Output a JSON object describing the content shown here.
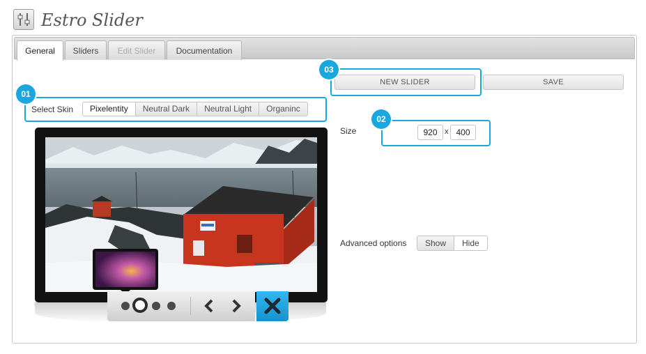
{
  "app": {
    "title": "Estro Slider",
    "icon": "sliders-app-icon"
  },
  "tabs": [
    {
      "label": "General",
      "active": true
    },
    {
      "label": "Sliders"
    },
    {
      "label": "Edit Slider",
      "disabled": true
    },
    {
      "label": "Documentation"
    }
  ],
  "callouts": {
    "one": "01",
    "two": "02",
    "three": "03"
  },
  "buttons": {
    "new_slider": "NEW SLIDER",
    "save": "SAVE"
  },
  "skin": {
    "label": "Select Skin",
    "options": [
      "Pixelentity",
      "Neutral Dark",
      "Neutral Light",
      "Organinc"
    ],
    "selected": "Pixelentity"
  },
  "size": {
    "label": "Size",
    "width": "920",
    "separator": "x",
    "height": "400"
  },
  "advanced": {
    "label": "Advanced options",
    "show": "Show",
    "hide": "Hide",
    "selected": "Hide"
  },
  "preview": {
    "active_slide": 2,
    "slide_count": 4
  },
  "colors": {
    "accent": "#1aa7df",
    "house": "#c8351f",
    "roof": "#2b2b2b"
  }
}
